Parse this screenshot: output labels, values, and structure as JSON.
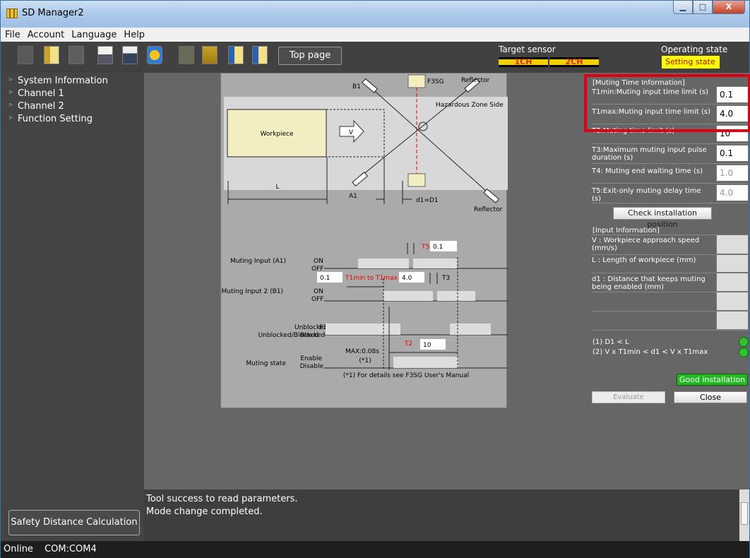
{
  "window": {
    "title": "SD Manager2",
    "min": "▁",
    "max": "□",
    "close": "X"
  },
  "menu": [
    "File",
    "Account",
    "Language",
    "Help"
  ],
  "toolbar": {
    "top_page": "Top page",
    "target_sensor_label": "Target sensor",
    "ch1": "1CH",
    "ch2": "2CH",
    "operating_state_label": "Operating state",
    "operating_state": "Setting state",
    "icons": [
      "device-icon",
      "folder-icon",
      "disabled-icon",
      "print-preview-icon",
      "print-icon",
      "transfer-icon",
      "lock-disabled-icon",
      "lock-icon",
      "book-icon",
      "book-gear-icon"
    ]
  },
  "sidebar": {
    "items": [
      "System Information",
      "Channel 1",
      "Channel 2",
      "Function Setting"
    ],
    "safety_button": "Safety Distance Calculation"
  },
  "diagram": {
    "b1": "B1",
    "f3sg": "F3SG",
    "reflector_top": "Reflector",
    "hazard": "Hazardous Zone Side",
    "workpiece": "Workpiece",
    "v": "V",
    "a1": "A1",
    "reflector_bottom": "Reflector",
    "l": "L",
    "d1": "d1=D1",
    "timing": {
      "muting_input_a1": "Muting Input (A1)",
      "muting_input_2_b1": "Muting Input 2 (B1)",
      "on": "ON",
      "off": "OFF",
      "f3sg": "F3SG",
      "unblocked_blocked": "Unblocked/Blocked",
      "unblocked": "Unblocked",
      "blocked": "Blocked",
      "muting_state": "Muting state",
      "enable": "Enable",
      "disable": "Disable",
      "max": "MAX:0.08s",
      "star1": "(*1)",
      "footnote": "(*1) For details see F3SG User's Manual",
      "t5_label": "T5",
      "t5_value": "0.1",
      "t1min_value": "0.1",
      "t1_range": "T1min to T1max",
      "t1max_value": "4.0",
      "t3_label": "T3",
      "t2_label": "T2",
      "t2_value": "10"
    }
  },
  "panel": {
    "muting_title": "[Muting Time Information]",
    "rows": [
      {
        "label": "T1min:Muting input time limit (s)",
        "value": "0.1",
        "disabled": false
      },
      {
        "label": "T1max:Muting input time limit (s)",
        "value": "4.0",
        "disabled": false
      },
      {
        "label": "T2:Muting time limit (s)",
        "value": "10",
        "disabled": false
      },
      {
        "label": "T3:Maximum muting input pulse duration (s)",
        "value": "0.1",
        "disabled": false
      },
      {
        "label": "T4: Muting end waiting time (s)",
        "value": "1.0",
        "disabled": true
      },
      {
        "label": "T5:Exit-only muting delay time (s)",
        "value": "4.0",
        "disabled": true
      }
    ],
    "check_button": "Check installation position",
    "input_title": "[Input Information]",
    "inputs": [
      "V : Workpiece approach speed (mm/s)",
      "L : Length of workpiece (mm)",
      "d1 : Distance that keeps muting being enabled (mm)",
      "",
      ""
    ],
    "conditions": [
      "(1) D1 < L",
      "(2) V x T1min < d1 < V x T1max"
    ],
    "good": "Good installation",
    "evaluate": "Evaluate",
    "close": "Close"
  },
  "log": [
    "Tool success to read parameters.",
    "Mode change completed."
  ],
  "status": {
    "online": "Online",
    "com": "COM:COM4"
  }
}
